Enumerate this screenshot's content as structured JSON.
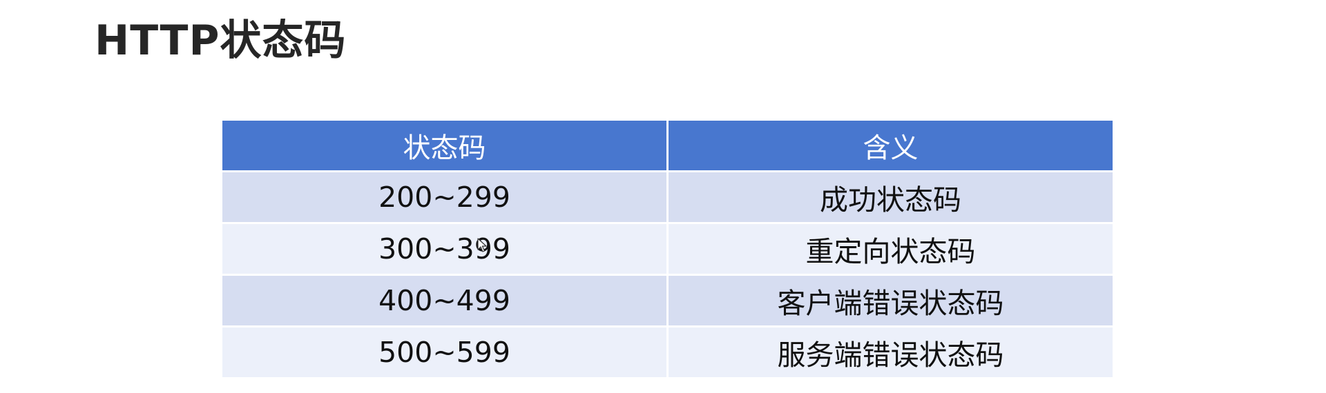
{
  "title": "HTTP状态码",
  "table": {
    "headers": [
      "状态码",
      "含义"
    ],
    "rows": [
      {
        "code": "200~299",
        "meaning": "成功状态码"
      },
      {
        "code": "300~399",
        "meaning": "重定向状态码"
      },
      {
        "code": "400~499",
        "meaning": "客户端错误状态码"
      },
      {
        "code": "500~599",
        "meaning": "服务端错误状态码"
      }
    ]
  },
  "colors": {
    "header_bg": "#4877cf",
    "row_odd_bg": "#d6ddf1",
    "row_even_bg": "#ecf0fa",
    "title_text": "#262626"
  }
}
